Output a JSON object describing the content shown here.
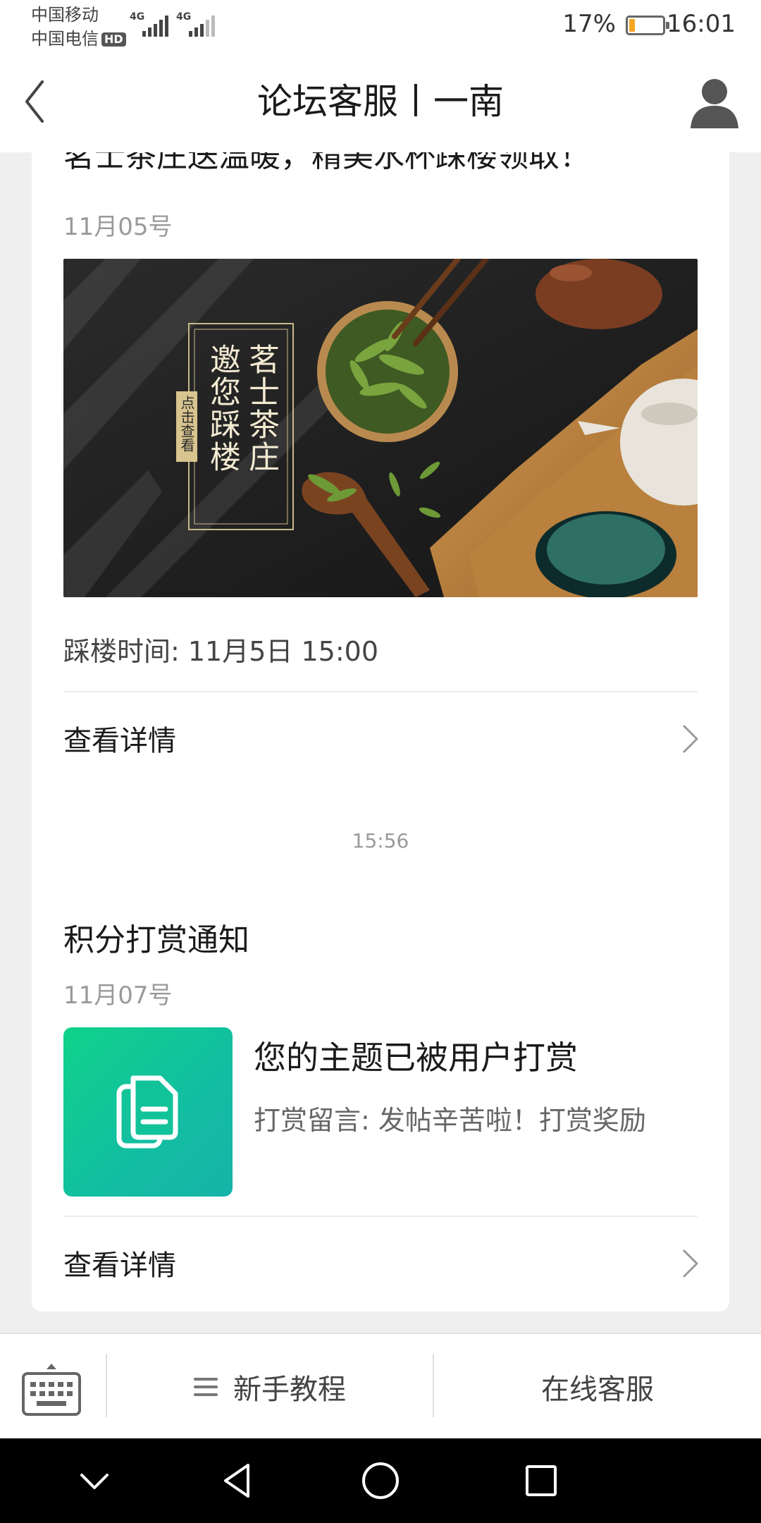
{
  "status_bar": {
    "carrier_1": "中国移动",
    "carrier_2": "中国电信",
    "hd_badge": "HD",
    "network_1": "4G",
    "network_2": "4G",
    "battery_percent": "17%",
    "battery_level": 0.17,
    "battery_color": "#f5a623",
    "time": "16:01"
  },
  "header": {
    "title": "论坛客服丨一南",
    "back_icon": "back-arrow-icon",
    "profile_icon": "user-profile-icon"
  },
  "card_event": {
    "title": "茗士茶庄送温暖，精美水杯踩楼领取！",
    "date": "11月05号",
    "banner": {
      "title_col1": "茗士茶庄",
      "title_col2": "邀您踩楼",
      "tag": "点击查看"
    },
    "event_time": "踩楼时间: 11月5日 15:00",
    "details_label": "查看详情"
  },
  "timestamp": "15:56",
  "card_points": {
    "title": "积分打赏通知",
    "date": "11月07号",
    "thumb_icon": "document-copy-icon",
    "message_title": "您的主题已被用户打赏",
    "message_text": "打赏留言: 发帖辛苦啦！打赏奖励",
    "details_label": "查看详情"
  },
  "bottom_menu": {
    "keyboard_icon": "keyboard-icon",
    "item_1": "新手教程",
    "item_2": "在线客服"
  },
  "nav_bar": {
    "icons": [
      "chevron-down-icon",
      "back-triangle-icon",
      "home-circle-icon",
      "recents-square-icon"
    ]
  }
}
